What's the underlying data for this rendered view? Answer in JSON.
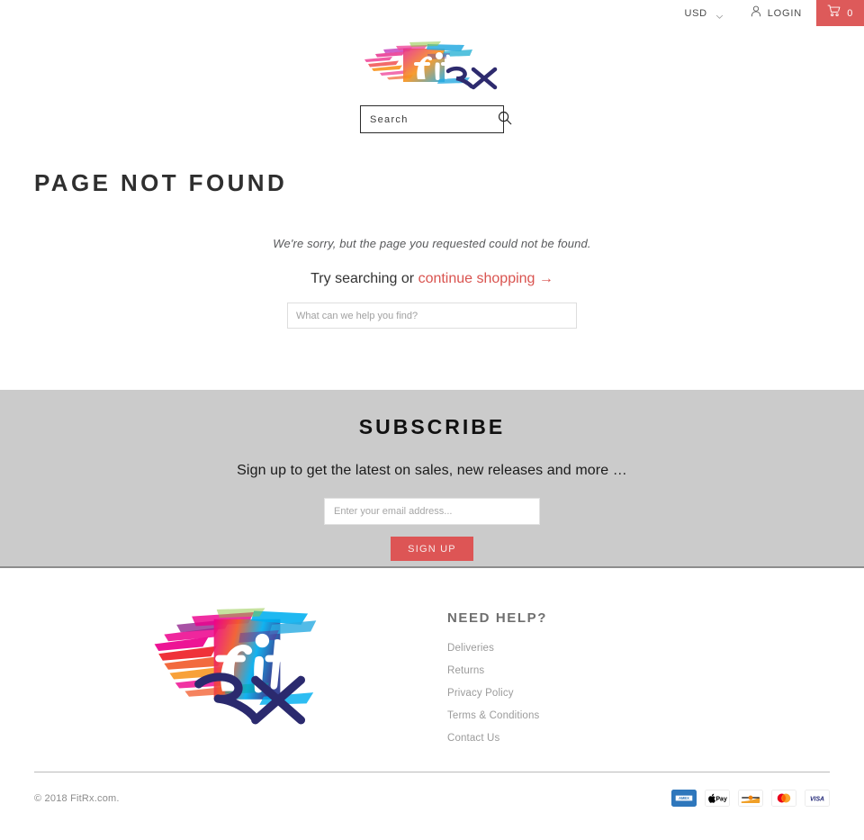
{
  "topbar": {
    "currency": "USD",
    "currency_icon": "chevron-down-icon",
    "login_label": "LOGIN",
    "login_icon": "user-icon",
    "cart_icon": "cart-icon",
    "cart_count": "0",
    "cart_color": "#dd5a5a"
  },
  "header": {
    "logo_alt": "fitRX",
    "search_placeholder": "Search",
    "search_value": "",
    "search_icon": "search-icon"
  },
  "main": {
    "page_title": "PAGE NOT FOUND",
    "sorry_text": "We're sorry, but the page you requested could not be found.",
    "try_prefix": "Try searching or ",
    "continue_link": "continue shopping →",
    "help_search_placeholder": "What can we help you find?",
    "help_search_value": "",
    "link_color": "#d9534f"
  },
  "subscribe": {
    "title": "SUBSCRIBE",
    "subtitle": "Sign up to get the latest on sales, new releases and more …",
    "email_placeholder": "Enter your email address...",
    "email_value": "",
    "button_label": "SIGN UP",
    "button_color": "#dd5555",
    "background_color": "#cbcbcb"
  },
  "footer": {
    "logo_alt": "fitRX",
    "need_help_title": "NEED HELP?",
    "links": [
      {
        "label": "Deliveries"
      },
      {
        "label": "Returns"
      },
      {
        "label": "Privacy Policy"
      },
      {
        "label": "Terms & Conditions"
      },
      {
        "label": "Contact Us"
      }
    ],
    "copyright": "© 2018 FitRx.com.",
    "payment_methods": [
      {
        "name": "amex-icon",
        "label": "AMEX"
      },
      {
        "name": "apple-pay-icon",
        "label": "Pay"
      },
      {
        "name": "discover-icon",
        "label": "DISCOVER"
      },
      {
        "name": "mastercard-icon",
        "label": "Mastercard"
      },
      {
        "name": "visa-icon",
        "label": "VISA"
      }
    ]
  }
}
